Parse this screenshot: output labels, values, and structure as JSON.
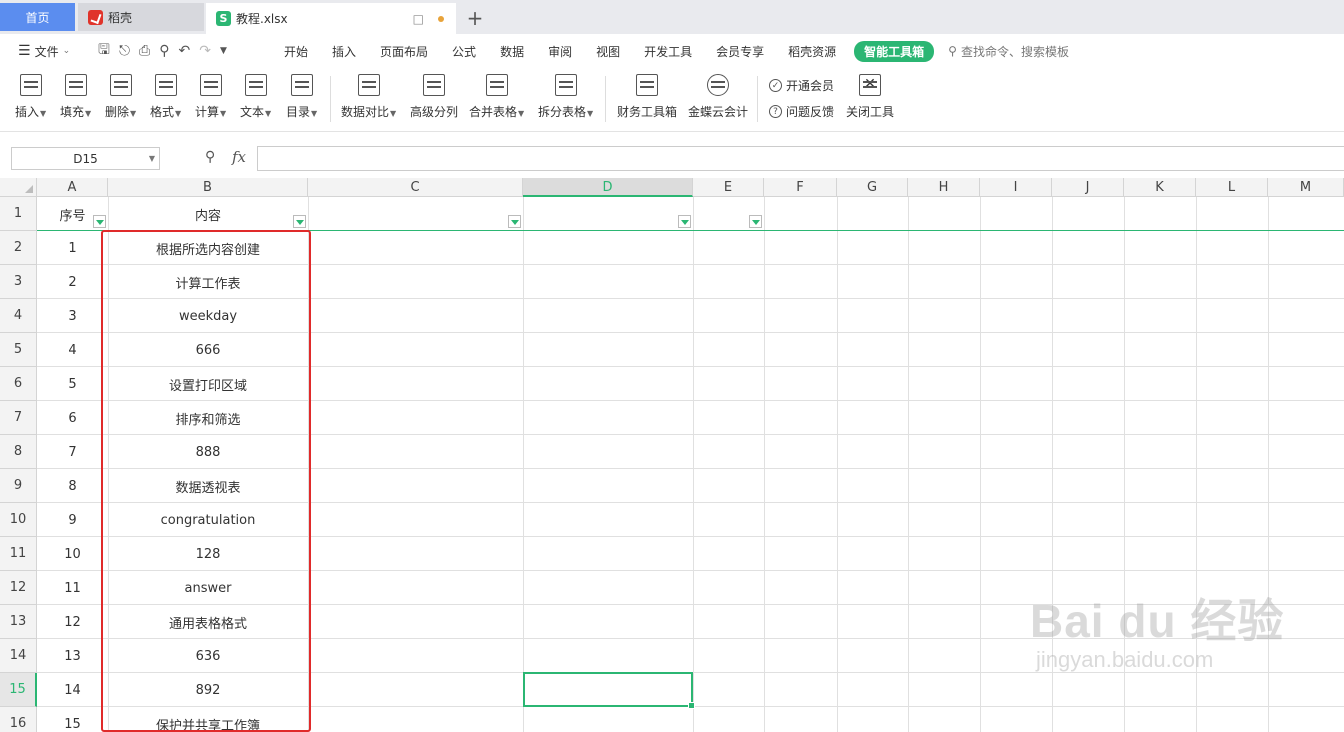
{
  "tabs": {
    "home": "首页",
    "daoke": "稻壳",
    "file": "教程.xlsx",
    "add": "+"
  },
  "menu": {
    "file": "文件",
    "items": [
      "开始",
      "插入",
      "页面布局",
      "公式",
      "数据",
      "审阅",
      "视图",
      "开发工具",
      "会员专享",
      "稻壳资源",
      "智能工具箱"
    ],
    "search": "查找命令、搜索模板"
  },
  "ribbon": {
    "insert": "插入",
    "fill": "填充",
    "delete": "删除",
    "format": "格式",
    "calc": "计算",
    "text": "文本",
    "toc": "目录",
    "data_compare": "数据对比",
    "advanced_split": "高级分列",
    "merge_table": "合并表格",
    "split_table": "拆分表格",
    "finance": "财务工具箱",
    "kingdee": "金蝶云会计",
    "vip": "开通会员",
    "feedback": "问题反馈",
    "close_tool": "关闭工具"
  },
  "formula": {
    "namebox": "D15",
    "fx": "fx",
    "value": ""
  },
  "sheet": {
    "columns": [
      "A",
      "B",
      "C",
      "D",
      "E",
      "F",
      "G",
      "H",
      "I",
      "J",
      "K",
      "L",
      "M"
    ],
    "selected_column": "D",
    "selected_row": "15",
    "header": {
      "row": "1",
      "a": "序号",
      "b": "内容"
    },
    "rows": [
      {
        "row": "2",
        "a": "1",
        "b": "根据所选内容创建"
      },
      {
        "row": "3",
        "a": "2",
        "b": "计算工作表"
      },
      {
        "row": "4",
        "a": "3",
        "b": "weekday"
      },
      {
        "row": "5",
        "a": "4",
        "b": "666"
      },
      {
        "row": "6",
        "a": "5",
        "b": "设置打印区域"
      },
      {
        "row": "7",
        "a": "6",
        "b": "排序和筛选"
      },
      {
        "row": "8",
        "a": "7",
        "b": "888"
      },
      {
        "row": "9",
        "a": "8",
        "b": "数据透视表"
      },
      {
        "row": "10",
        "a": "9",
        "b": "congratulation"
      },
      {
        "row": "11",
        "a": "10",
        "b": "128"
      },
      {
        "row": "12",
        "a": "11",
        "b": "answer"
      },
      {
        "row": "13",
        "a": "12",
        "b": "通用表格格式"
      },
      {
        "row": "14",
        "a": "13",
        "b": "636"
      },
      {
        "row": "15",
        "a": "14",
        "b": "892"
      },
      {
        "row": "16",
        "a": "15",
        "b": "保护并共享工作簿"
      }
    ]
  },
  "watermark": {
    "main": "Bai du 经验",
    "sub": "jingyan.baidu.com"
  },
  "colors": {
    "accent": "#2bb673",
    "highlight": "#e02a2a",
    "home_tab": "#5b8def"
  }
}
